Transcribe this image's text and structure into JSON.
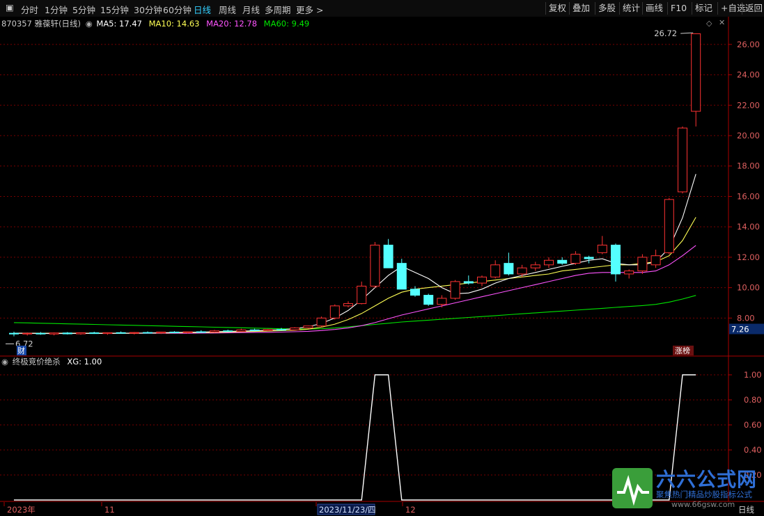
{
  "toolbar": {
    "periods": [
      "分时",
      "1分钟",
      "5分钟",
      "15分钟",
      "30分钟",
      "60分钟",
      "日线",
      "周线",
      "月线",
      "多周期",
      "更多 >"
    ],
    "active_index": 6,
    "right": [
      "复权",
      "叠加",
      "多股",
      "统计",
      "画线",
      "F10",
      "标记",
      "+自选",
      "返回"
    ]
  },
  "legend": {
    "code_name": "870357 雅葆轩(日线)",
    "ma5": "MA5: 17.47",
    "ma10": "MA10: 14.63",
    "ma20": "MA20: 12.78",
    "ma60": "MA60: 9.49",
    "indicator": "终极竞价绝杀",
    "xg": "XG: 1.00"
  },
  "labels": {
    "high": "26.72",
    "low": "6.72",
    "current": "7.26",
    "cai": "财",
    "zhang": "涨榜",
    "period_tag": "日线"
  },
  "watermark": {
    "brand": "六六公式网",
    "slogan": "聚焦热门精品炒股指标公式",
    "url": "www.66gsw.com"
  },
  "colors": {
    "up": "#ff3232",
    "down": "#54ffff",
    "ma5": "#ffffff",
    "ma10": "#ffff54",
    "ma20": "#ff54ff",
    "ma60": "#00e600",
    "grid": "#7a0000",
    "axis": "#aa0000"
  },
  "chart_data": [
    {
      "type": "candlestick",
      "title": "870357 雅葆轩(日线)",
      "ylim": [
        5.5,
        27.0
      ],
      "y_ticks": [
        "26.00",
        "24.00",
        "22.00",
        "20.00",
        "18.00",
        "16.00",
        "14.00",
        "12.00",
        "10.00",
        "8.00"
      ],
      "x_ticks": [
        "2023年",
        "11",
        "2023/11/23/四",
        "12"
      ],
      "candles": [
        [
          7.0,
          7.1,
          6.8,
          6.95
        ],
        [
          6.95,
          7.05,
          6.85,
          7.0
        ],
        [
          7.0,
          7.08,
          6.9,
          6.95
        ],
        [
          6.95,
          7.05,
          6.86,
          7.02
        ],
        [
          7.02,
          7.08,
          6.92,
          6.96
        ],
        [
          6.96,
          7.05,
          6.9,
          7.03
        ],
        [
          7.03,
          7.1,
          6.96,
          6.98
        ],
        [
          6.98,
          7.06,
          6.9,
          7.04
        ],
        [
          7.04,
          7.12,
          6.98,
          7.0
        ],
        [
          7.0,
          7.08,
          6.92,
          7.05
        ],
        [
          7.05,
          7.12,
          7.0,
          7.02
        ],
        [
          7.02,
          7.1,
          6.95,
          7.08
        ],
        [
          7.08,
          7.14,
          7.0,
          7.04
        ],
        [
          7.04,
          7.12,
          6.98,
          7.1
        ],
        [
          7.1,
          7.2,
          7.05,
          7.08
        ],
        [
          7.08,
          7.22,
          7.04,
          7.16
        ],
        [
          7.16,
          7.24,
          7.1,
          7.12
        ],
        [
          7.12,
          7.3,
          7.1,
          7.22
        ],
        [
          7.22,
          7.3,
          7.15,
          7.18
        ],
        [
          7.18,
          7.28,
          7.14,
          7.25
        ],
        [
          7.25,
          7.35,
          7.2,
          7.22
        ],
        [
          7.22,
          7.4,
          7.2,
          7.35
        ],
        [
          7.35,
          7.5,
          7.3,
          7.48
        ],
        [
          7.48,
          8.1,
          7.4,
          8.0
        ],
        [
          8.0,
          8.9,
          7.9,
          8.8
        ],
        [
          8.8,
          9.1,
          8.7,
          8.95
        ],
        [
          8.95,
          10.4,
          8.9,
          10.1
        ],
        [
          10.1,
          13.0,
          10.0,
          12.8
        ],
        [
          12.8,
          13.2,
          11.5,
          11.3
        ],
        [
          11.6,
          11.9,
          9.9,
          9.9
        ],
        [
          9.9,
          10.1,
          9.4,
          9.5
        ],
        [
          9.5,
          9.6,
          8.8,
          8.9
        ],
        [
          8.9,
          9.5,
          8.7,
          9.3
        ],
        [
          9.3,
          10.5,
          9.2,
          10.4
        ],
        [
          10.4,
          10.8,
          10.2,
          10.3
        ],
        [
          10.3,
          10.8,
          10.1,
          10.7
        ],
        [
          10.7,
          11.8,
          10.6,
          11.5
        ],
        [
          11.6,
          12.3,
          10.8,
          10.9
        ],
        [
          10.9,
          11.5,
          10.7,
          11.3
        ],
        [
          11.3,
          11.7,
          11.1,
          11.5
        ],
        [
          11.5,
          12.0,
          11.3,
          11.8
        ],
        [
          11.8,
          12.0,
          11.5,
          11.6
        ],
        [
          11.6,
          12.4,
          11.5,
          12.2
        ],
        [
          12.0,
          12.1,
          11.6,
          11.9
        ],
        [
          12.3,
          13.4,
          12.2,
          12.8
        ],
        [
          12.8,
          12.9,
          10.4,
          10.9
        ],
        [
          10.9,
          11.2,
          10.6,
          11.1
        ],
        [
          11.1,
          12.2,
          10.9,
          12.0
        ],
        [
          11.5,
          12.5,
          11.3,
          12.1
        ],
        [
          12.3,
          15.9,
          12.2,
          15.8
        ],
        [
          16.3,
          20.6,
          16.2,
          20.5
        ],
        [
          21.6,
          26.72,
          20.6,
          26.7
        ]
      ],
      "ma5": [
        7.0,
        7.0,
        6.98,
        6.98,
        6.98,
        6.99,
        6.99,
        6.99,
        7.0,
        7.01,
        7.02,
        7.03,
        7.05,
        7.06,
        7.08,
        7.1,
        7.12,
        7.14,
        7.16,
        7.2,
        7.24,
        7.3,
        7.42,
        7.65,
        8.0,
        8.5,
        9.2,
        10.0,
        10.8,
        11.4,
        11.0,
        10.6,
        10.0,
        9.6,
        9.65,
        9.9,
        10.3,
        10.6,
        10.8,
        11.0,
        11.2,
        11.4,
        11.6,
        11.8,
        11.9,
        11.6,
        11.5,
        11.5,
        11.7,
        12.6,
        14.6,
        17.47
      ],
      "ma10": [
        7.0,
        7.0,
        7.0,
        7.0,
        7.0,
        7.0,
        7.0,
        7.0,
        7.0,
        7.0,
        7.01,
        7.02,
        7.03,
        7.04,
        7.05,
        7.06,
        7.08,
        7.1,
        7.12,
        7.14,
        7.17,
        7.2,
        7.27,
        7.4,
        7.6,
        7.9,
        8.3,
        8.8,
        9.3,
        9.7,
        9.9,
        10.0,
        10.1,
        10.2,
        10.3,
        10.4,
        10.5,
        10.6,
        10.7,
        10.8,
        10.9,
        11.1,
        11.2,
        11.3,
        11.4,
        11.5,
        11.5,
        11.6,
        11.7,
        12.1,
        13.1,
        14.63
      ],
      "ma20": [
        7.0,
        7.0,
        7.0,
        7.0,
        7.0,
        7.0,
        7.0,
        7.0,
        7.0,
        7.0,
        7.0,
        7.0,
        7.0,
        7.0,
        7.01,
        7.02,
        7.03,
        7.04,
        7.05,
        7.06,
        7.08,
        7.1,
        7.13,
        7.18,
        7.25,
        7.35,
        7.5,
        7.7,
        7.95,
        8.2,
        8.4,
        8.6,
        8.8,
        9.0,
        9.2,
        9.4,
        9.6,
        9.8,
        10.0,
        10.2,
        10.4,
        10.6,
        10.8,
        10.95,
        11.0,
        11.0,
        11.0,
        11.0,
        11.1,
        11.5,
        12.1,
        12.78
      ],
      "ma60": [
        7.7,
        7.68,
        7.66,
        7.64,
        7.62,
        7.6,
        7.58,
        7.56,
        7.54,
        7.52,
        7.5,
        7.48,
        7.46,
        7.44,
        7.42,
        7.4,
        7.38,
        7.36,
        7.34,
        7.32,
        7.3,
        7.28,
        7.28,
        7.3,
        7.35,
        7.42,
        7.5,
        7.58,
        7.66,
        7.74,
        7.8,
        7.86,
        7.92,
        7.98,
        8.04,
        8.1,
        8.16,
        8.22,
        8.28,
        8.34,
        8.4,
        8.46,
        8.52,
        8.58,
        8.64,
        8.7,
        8.76,
        8.82,
        8.9,
        9.05,
        9.25,
        9.49
      ]
    },
    {
      "type": "line",
      "title": "终极竞价绝杀",
      "ylim": [
        0,
        1.1
      ],
      "y_ticks": [
        "1.00",
        "0.80",
        "0.60",
        "0.40",
        "0.20"
      ],
      "series": [
        {
          "name": "XG",
          "values": [
            0,
            0,
            0,
            0,
            0,
            0,
            0,
            0,
            0,
            0,
            0,
            0,
            0,
            0,
            0,
            0,
            0,
            0,
            0,
            0,
            0,
            0,
            0,
            0,
            0,
            0,
            0,
            1,
            1,
            0,
            0,
            0,
            0,
            0,
            0,
            0,
            0,
            0,
            0,
            0,
            0,
            0,
            0,
            0,
            0,
            0,
            0,
            0,
            0,
            0,
            1,
            1
          ]
        }
      ]
    }
  ]
}
